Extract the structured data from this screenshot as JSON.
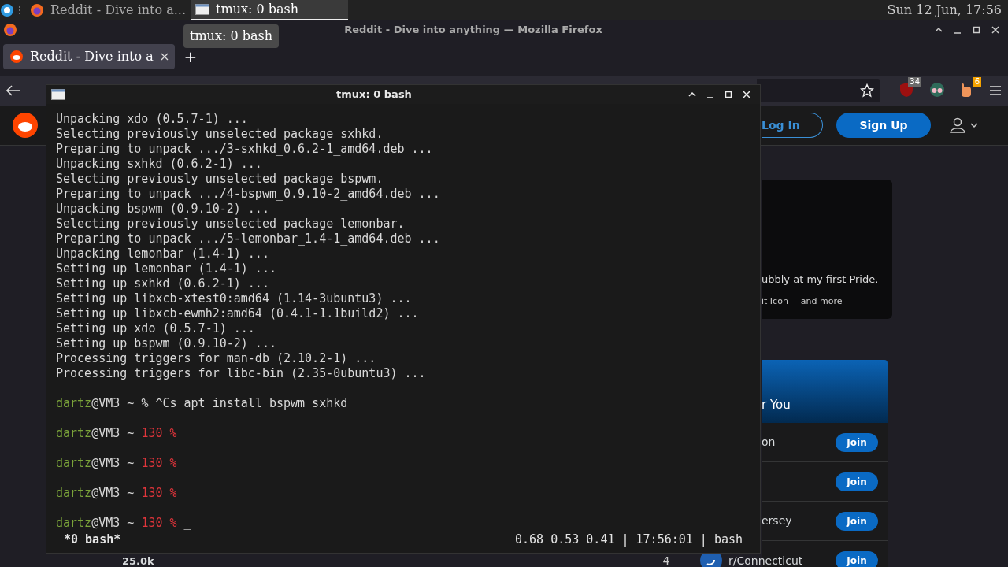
{
  "panel": {
    "tasks": [
      {
        "kind": "browser",
        "label": "Reddit - Dive into a...",
        "selected": false
      },
      {
        "kind": "terminal",
        "label": "tmux: 0 bash",
        "selected": true
      }
    ],
    "clock": "Sun 12 Jun, 17:56"
  },
  "tooltip": "tmux: 0 bash",
  "browser": {
    "title": "Reddit - Dive into anything — Mozilla Firefox",
    "tabs": [
      {
        "label": "Reddit - Dive into a",
        "selected": true
      }
    ],
    "new_tab": "+",
    "extensions": [
      {
        "kind": "shield",
        "badge": "34",
        "color": "#6b6b6b"
      },
      {
        "kind": "face"
      },
      {
        "kind": "hand",
        "badge": "6",
        "color": "#f5a300"
      }
    ]
  },
  "reddit": {
    "login": "Log In",
    "signup": "Sign Up",
    "card": {
      "text": "ubbly at my first Pride.",
      "meta": [
        "it Icon",
        "and more"
      ]
    },
    "communities": {
      "title": "r You",
      "items": [
        {
          "name": "on",
          "join": "Join"
        },
        {
          "join": "Join"
        },
        {
          "name": "ersey",
          "join": "Join"
        },
        {
          "rank": "4",
          "name": "r/Connecticut",
          "join": "Join"
        }
      ]
    },
    "post_score": "25.0k"
  },
  "terminal": {
    "title": "tmux: 0 bash",
    "lines": [
      {
        "kind": "output",
        "text": "Unpacking xdo (0.5.7-1) ..."
      },
      {
        "kind": "output",
        "text": "Selecting previously unselected package sxhkd."
      },
      {
        "kind": "output",
        "text": "Preparing to unpack .../3-sxhkd_0.6.2-1_amd64.deb ..."
      },
      {
        "kind": "output",
        "text": "Unpacking sxhkd (0.6.2-1) ..."
      },
      {
        "kind": "output",
        "text": "Selecting previously unselected package bspwm."
      },
      {
        "kind": "output",
        "text": "Preparing to unpack .../4-bspwm_0.9.10-2_amd64.deb ..."
      },
      {
        "kind": "output",
        "text": "Unpacking bspwm (0.9.10-2) ..."
      },
      {
        "kind": "output",
        "text": "Selecting previously unselected package lemonbar."
      },
      {
        "kind": "output",
        "text": "Preparing to unpack .../5-lemonbar_1.4-1_amd64.deb ..."
      },
      {
        "kind": "output",
        "text": "Unpacking lemonbar (1.4-1) ..."
      },
      {
        "kind": "output",
        "text": "Setting up lemonbar (1.4-1) ..."
      },
      {
        "kind": "output",
        "text": "Setting up sxhkd (0.6.2-1) ..."
      },
      {
        "kind": "output",
        "text": "Setting up libxcb-xtest0:amd64 (1.14-3ubuntu3) ..."
      },
      {
        "kind": "output",
        "text": "Setting up libxcb-ewmh2:amd64 (0.4.1-1.1build2) ..."
      },
      {
        "kind": "output",
        "text": "Setting up xdo (0.5.7-1) ..."
      },
      {
        "kind": "output",
        "text": "Setting up bspwm (0.9.10-2) ..."
      },
      {
        "kind": "output",
        "text": "Processing triggers for man-db (2.10.2-1) ..."
      },
      {
        "kind": "output",
        "text": "Processing triggers for libc-bin (2.35-0ubuntu3) ..."
      },
      {
        "kind": "blank"
      },
      {
        "kind": "prompt",
        "user": "dartz",
        "host": "@VM3 ~",
        "end": "%",
        "command": "^Cs apt install bspwm sxhkd"
      },
      {
        "kind": "blank"
      },
      {
        "kind": "prompt",
        "user": "dartz",
        "host": "@VM3 ~",
        "status": "130 %"
      },
      {
        "kind": "blank"
      },
      {
        "kind": "prompt",
        "user": "dartz",
        "host": "@VM3 ~",
        "status": "130 %"
      },
      {
        "kind": "blank"
      },
      {
        "kind": "prompt",
        "user": "dartz",
        "host": "@VM3 ~",
        "status": "130 %"
      },
      {
        "kind": "blank"
      },
      {
        "kind": "prompt",
        "user": "dartz",
        "host": "@VM3 ~",
        "status": "130 %",
        "cursor": "_"
      }
    ],
    "status_left": "*0 bash*",
    "status_right": "0.68 0.53 0.41 | 17:56:01 | bash"
  }
}
